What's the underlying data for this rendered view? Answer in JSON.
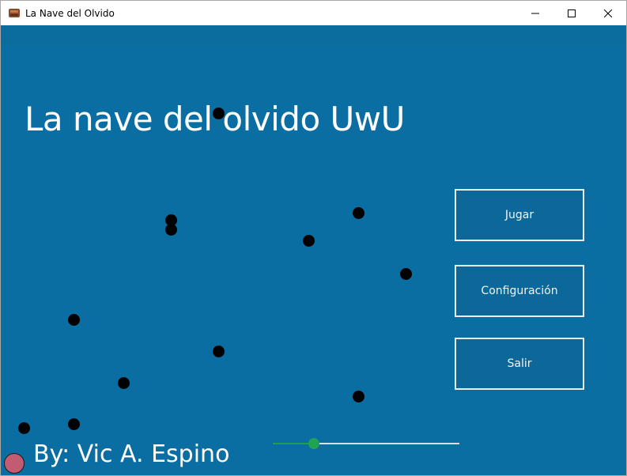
{
  "window": {
    "title": "La Nave del Olvido",
    "icon": "ship-icon",
    "controls": [
      "minimize-icon",
      "maximize-icon",
      "close-icon"
    ]
  },
  "game": {
    "title": "La nave del olvido UwU",
    "author": "By: Vic A. Espino"
  },
  "menu": {
    "play_label": "Jugar",
    "config_label": "Configuración",
    "exit_label": "Salir"
  },
  "slider": {
    "value_fraction": 0.22
  },
  "colors": {
    "background": "#0a6ea3",
    "button_border": "#e8eef2",
    "slider_accent": "#22a353",
    "player": "#c25c73",
    "obstacle": "#000000"
  }
}
